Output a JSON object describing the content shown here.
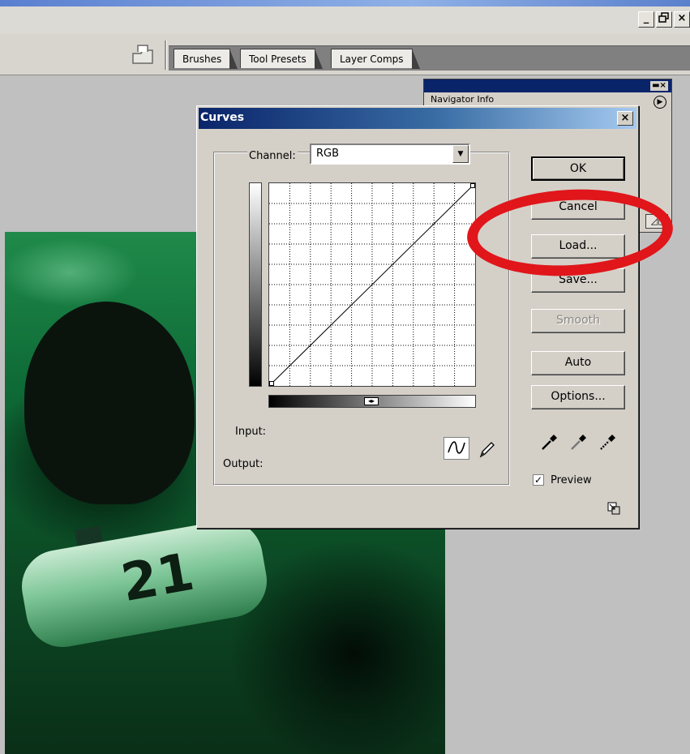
{
  "window_controls": {
    "minimize": "_",
    "restore": "🗗",
    "close": "×"
  },
  "palette_well": {
    "tabs": [
      "Brushes",
      "Tool Presets",
      "Layer Comps"
    ]
  },
  "navigator_palette": {
    "tabs_text": "Navigator  Info"
  },
  "photo": {
    "tank_number": "21"
  },
  "dialog": {
    "title": "Curves",
    "close": "×",
    "channel_label": "Channel:",
    "channel_value": "RGB",
    "input_label": "Input:",
    "output_label": "Output:",
    "buttons": {
      "ok": "OK",
      "cancel": "Cancel",
      "load": "Load...",
      "save": "Save...",
      "smooth": "Smooth",
      "auto": "Auto",
      "options": "Options..."
    },
    "preview_label": "Preview",
    "preview_checked": true
  },
  "annotation": {
    "color": "#e0161b"
  }
}
